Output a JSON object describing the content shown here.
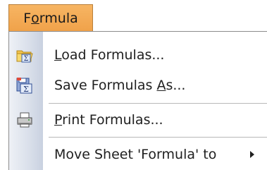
{
  "menu": {
    "title_prefix": "F",
    "title_mnemonic": "o",
    "title_suffix": "rmula"
  },
  "items": [
    {
      "icon": "load-formulas-icon",
      "pre": "",
      "mn": "L",
      "post": "oad Formulas..."
    },
    {
      "icon": "save-formulas-icon",
      "pre": "Save Formulas ",
      "mn": "A",
      "post": "s..."
    },
    {
      "icon": "printer-icon",
      "pre": "",
      "mn": "P",
      "post": "rint Formulas..."
    },
    {
      "icon": "",
      "pre": "Move Sheet 'Formula' to",
      "mn": "",
      "post": ""
    }
  ],
  "colors": {
    "menu_header": "#f0a24a",
    "gutter": "#d9dfea"
  }
}
